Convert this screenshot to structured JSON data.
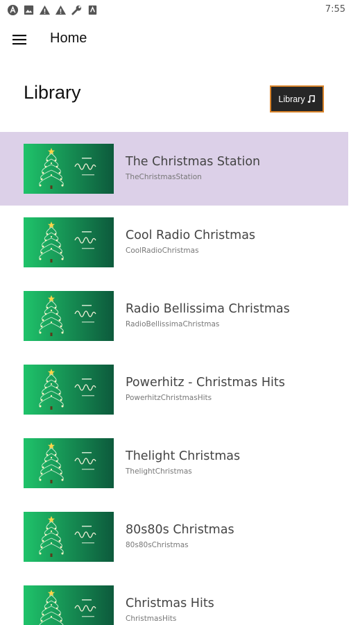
{
  "status_bar": {
    "time": "7:55",
    "icons": [
      "android-a-icon",
      "image-icon",
      "warning-icon",
      "warning-icon",
      "wrench-icon",
      "badge-icon"
    ]
  },
  "app_bar": {
    "menu_icon": "hamburger-menu-icon",
    "title": "Home"
  },
  "library": {
    "title": "Library",
    "button_label": "Library",
    "button_icon": "music-note-icon"
  },
  "stations": [
    {
      "name": "The Christmas Station",
      "id": "TheChristmasStation",
      "selected": true
    },
    {
      "name": "Cool Radio Christmas",
      "id": "CoolRadioChristmas",
      "selected": false
    },
    {
      "name": "Radio Bellissima Christmas",
      "id": "RadioBellissimaChristmas",
      "selected": false
    },
    {
      "name": "Powerhitz - Christmas Hits",
      "id": "PowerhitzChristmasHits",
      "selected": false
    },
    {
      "name": "Thelight Christmas",
      "id": "ThelightChristmas",
      "selected": false
    },
    {
      "name": "80s80s Christmas",
      "id": "80s80sChristmas",
      "selected": false
    },
    {
      "name": "Christmas Hits",
      "id": "ChristmasHits",
      "selected": false
    }
  ],
  "colors": {
    "selected_row": "#dcd0e8",
    "library_button_bg": "#262626",
    "library_button_border": "#d9842a",
    "thumb_green_light": "#1fc36a",
    "thumb_green_dark": "#0d5a3c"
  }
}
